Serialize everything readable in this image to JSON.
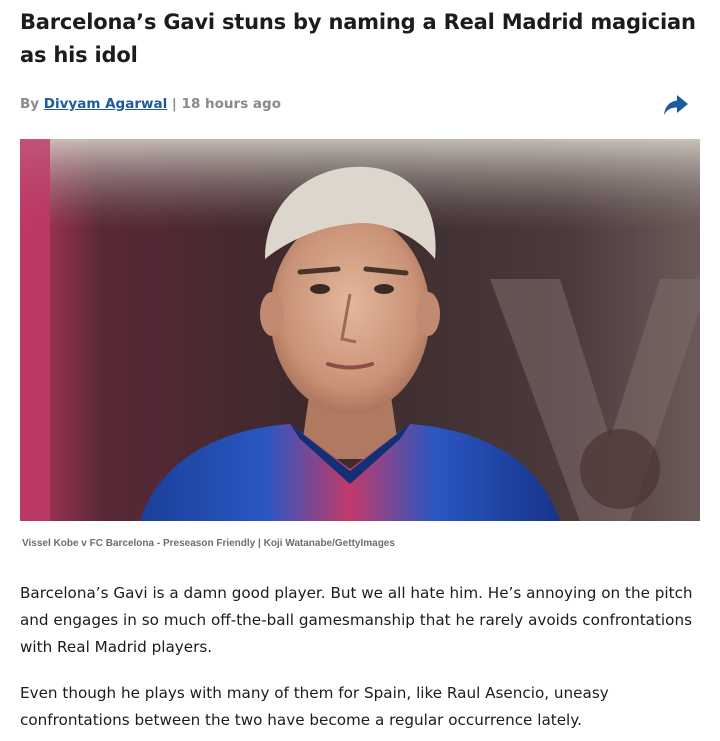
{
  "article": {
    "headline": "Barcelona’s Gavi stuns by naming a Real Madrid magician as his idol",
    "byline_prefix": "By ",
    "author": "Divyam Agarwal",
    "separator": " | ",
    "time": "18 hours ago",
    "share_icon": "share-arrow-icon",
    "image_caption": "Vissel Kobe v FC Barcelona - Preseason Friendly | Koji Watanabe/GettyImages",
    "paragraphs": [
      "Barcelona’s Gavi is a damn good player. But we all hate him. He’s annoying on the pitch and engages in so much off-the-ball gamesmanship that he rarely avoids confrontations with Real Madrid players.",
      "Even though he plays with many of them for Spain, like Raul Asencio, uneasy confrontations between the two have become a regular occurrence lately."
    ]
  },
  "colors": {
    "author_link": "#1d5a9e",
    "share_icon": "#1d5a9e",
    "meta_text": "#8a8a8a",
    "body_text": "#1c1c1c"
  }
}
